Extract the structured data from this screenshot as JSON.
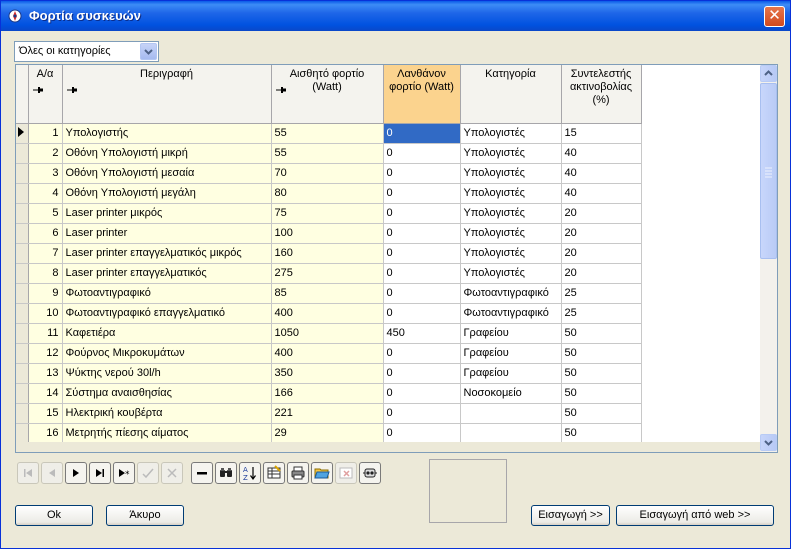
{
  "window": {
    "title": "Φορτία συσκευών"
  },
  "filter": {
    "selected": "Όλες οι κατηγορίες"
  },
  "table": {
    "columns": [
      {
        "label": "Α/α",
        "pinned": true
      },
      {
        "label": "Περιγραφή",
        "pinned": true
      },
      {
        "label": "Αισθητό φορτίο (Watt)",
        "pinned": true
      },
      {
        "label": "Λανθάνον φορτίο (Watt)",
        "pinned": false,
        "selected": true
      },
      {
        "label": "Κατηγορία",
        "pinned": false
      },
      {
        "label": "Συντελεστής ακτινοβολίας (%)",
        "pinned": false
      }
    ],
    "rows": [
      [
        "1",
        "Υπολογιστής",
        "55",
        "0",
        "Υπολογιστές",
        "15"
      ],
      [
        "2",
        "Οθόνη Υπολογιστή μικρή",
        "55",
        "0",
        "Υπολογιστές",
        "40"
      ],
      [
        "3",
        "Οθόνη Υπολογιστή μεσαία",
        "70",
        "0",
        "Υπολογιστές",
        "40"
      ],
      [
        "4",
        "Οθόνη Υπολογιστή μεγάλη",
        "80",
        "0",
        "Υπολογιστές",
        "40"
      ],
      [
        "5",
        "Laser printer μικρός",
        "75",
        "0",
        "Υπολογιστές",
        "20"
      ],
      [
        "6",
        "Laser printer",
        "100",
        "0",
        "Υπολογιστές",
        "20"
      ],
      [
        "7",
        "Laser printer επαγγελματικός μικρός",
        "160",
        "0",
        "Υπολογιστές",
        "20"
      ],
      [
        "8",
        "Laser printer επαγγελματικός",
        "275",
        "0",
        "Υπολογιστές",
        "20"
      ],
      [
        "9",
        "Φωτοαντιγραφικό",
        "85",
        "0",
        "Φωτοαντιγραφικό",
        "25"
      ],
      [
        "10",
        "Φωτοαντιγραφικό επαγγελματικό",
        "400",
        "0",
        "Φωτοαντιγραφικό",
        "25"
      ],
      [
        "11",
        "Καφετιέρα",
        "1050",
        "450",
        "Γραφείου",
        "50"
      ],
      [
        "12",
        "Φούρνος Μικροκυμάτων",
        "400",
        "0",
        "Γραφείου",
        "50"
      ],
      [
        "13",
        "Ψύκτης νερού 30l/h",
        "350",
        "0",
        "Γραφείου",
        "50"
      ],
      [
        "14",
        "Σύστημα αναισθησίας",
        "166",
        "0",
        "Νοσοκομείο",
        "50"
      ],
      [
        "15",
        "Ηλεκτρική κουβέρτα",
        "221",
        "0",
        "",
        "50"
      ],
      [
        "16",
        "Μετρητής πίεσης αίματος",
        "29",
        "0",
        "",
        "50"
      ]
    ]
  },
  "buttons": {
    "ok": "Ok",
    "cancel": "Άκυρο",
    "insert": "Εισαγωγή >>",
    "insert_web": "Εισαγωγή από web >>"
  },
  "toolbar": {
    "icons": [
      "first-record-icon",
      "prev-record-icon",
      "next-record-icon",
      "last-record-icon",
      "new-record-icon",
      "post-icon",
      "cancel-edit-icon",
      "delete-record-icon",
      "find-icon",
      "sort-icon",
      "grid-settings-icon",
      "print-icon",
      "open-folder-icon",
      "clear-icon",
      "network-icon"
    ]
  },
  "colors": {
    "title_gradient": "#0052e0",
    "selected_header": "#fbd38e",
    "frozen_cell": "#ffffe1",
    "active_cell": "#316ac5"
  }
}
